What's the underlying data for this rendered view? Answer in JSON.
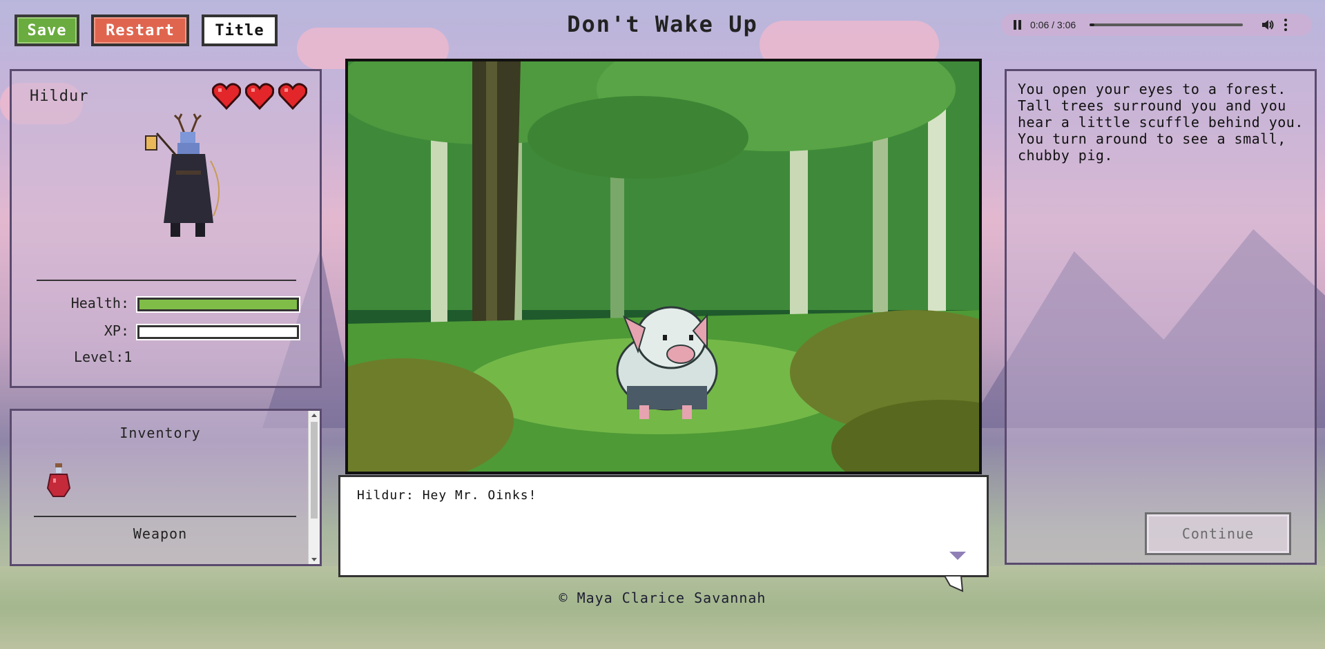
{
  "toolbar": {
    "save_label": "Save",
    "restart_label": "Restart",
    "title_label": "Title"
  },
  "game_title": "Don't Wake Up",
  "audio": {
    "time": "0:06 / 3:06",
    "progress": 0.032,
    "play_icon": "pause-icon",
    "volume_icon": "volume-icon",
    "menu_icon": "more-vert-icon"
  },
  "character": {
    "name": "Hildur",
    "hearts": 3,
    "health_label": "Health:",
    "health_value": 1.0,
    "xp_label": "XP:",
    "xp_value": 0.0,
    "level_label": "Level:1"
  },
  "inventory": {
    "title": "Inventory",
    "items": [
      {
        "icon": "red-potion-icon"
      }
    ],
    "weapon_title": "Weapon"
  },
  "scene": {
    "image": "forest-pig-scene"
  },
  "dialog": {
    "text": "Hildur: Hey Mr. Oinks!"
  },
  "credit": "© Maya Clarice Savannah",
  "narration": {
    "text": "You open your eyes to a forest. Tall trees surround you and you hear a little scuffle behind you. You turn around to see a small, chubby pig.",
    "continue_label": "Continue"
  },
  "colors": {
    "save": "#6aac3f",
    "restart": "#e0654f",
    "health": "#7fbd48",
    "panel_border": "#5a4a6e"
  }
}
